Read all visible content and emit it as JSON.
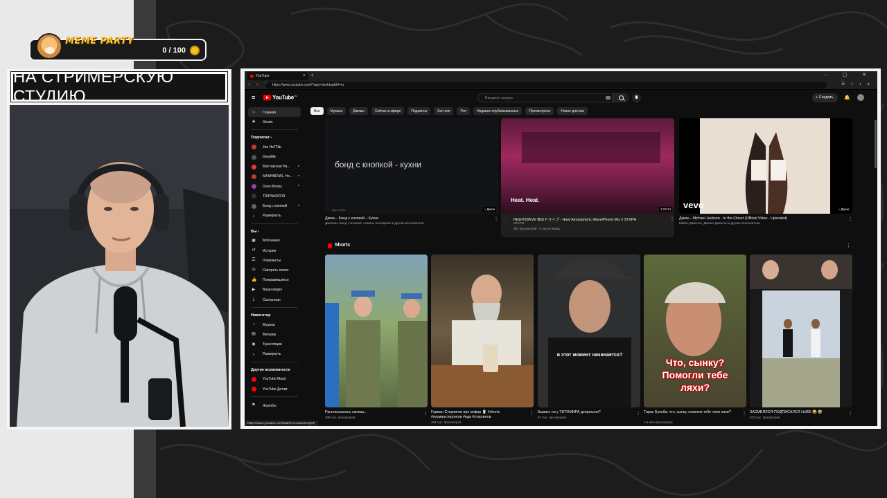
{
  "overlay": {
    "meme_party": {
      "title": "MEME PARTY",
      "counter": "0 / 100"
    },
    "cam_title": "НА СТРИМЕРСКУЮ СТУДИЮ"
  },
  "browser": {
    "tab_title": "YouTube",
    "url": "https://www.youtube.com/?app=desktop&hl=ru",
    "status_url": "https://www.youtube.com/watch?v=uzakUvuQOF"
  },
  "youtube": {
    "logo_text": "YouTube",
    "logo_region": "RU",
    "search_placeholder": "Введите запрос",
    "create_label": "Создать",
    "sidebar": {
      "main": [
        {
          "label": "Главная",
          "icon": "home-icon",
          "active": true
        },
        {
          "label": "Shorts",
          "icon": "shorts-icon",
          "active": false
        }
      ],
      "subs_title": "Подписки",
      "subscriptions": [
        {
          "label": "Joe HaTTab",
          "color": "#c0392b",
          "dot": false
        },
        {
          "label": "DeepMe",
          "color": "#555555",
          "dot": false
        },
        {
          "label": "Мастерская На...",
          "color": "#e23b3b",
          "dot": true
        },
        {
          "label": "MASHNEWS. Но...",
          "color": "#c0392b",
          "dot": true
        },
        {
          "label": "Drow Binsky",
          "color": "#8e44ad",
          "dot": true
        },
        {
          "label": "TRIPNADZOR",
          "color": "#333333",
          "dot": false
        },
        {
          "label": "Бонд с кнопкой",
          "color": "#666666",
          "dot": true
        }
      ],
      "expand_label": "Развернуть",
      "you_title": "Вы",
      "you_items": [
        {
          "label": "Мой канал",
          "icon": "channel-icon"
        },
        {
          "label": "История",
          "icon": "history-icon"
        },
        {
          "label": "Плейлисты",
          "icon": "playlists-icon"
        },
        {
          "label": "Смотреть позже",
          "icon": "watch-later-icon"
        },
        {
          "label": "Понравившиеся",
          "icon": "like-icon"
        },
        {
          "label": "Ваши видео",
          "icon": "your-videos-icon"
        },
        {
          "label": "Скачанные",
          "icon": "download-icon"
        }
      ],
      "nav_title": "Навигатор",
      "nav_items": [
        {
          "label": "Музыка",
          "icon": "music-icon"
        },
        {
          "label": "Фильмы",
          "icon": "film-icon"
        },
        {
          "label": "Трансляции",
          "icon": "live-icon"
        }
      ],
      "nav_expand": "Развернуть",
      "more_title": "Другие возможности",
      "more_items": [
        {
          "label": "YouTube Music",
          "icon": "yt-music-icon"
        },
        {
          "label": "YouTube Детям",
          "icon": "yt-kids-icon"
        }
      ],
      "complaints": "Жалобы"
    },
    "chips": [
      "Все",
      "Музыка",
      "Джемы",
      "Сейчас в эфире",
      "Подкасты",
      "Хип-хоп",
      "Рэп",
      "Недавно опубликованные",
      "Просмотрено",
      "Новое для вас"
    ],
    "videos": [
      {
        "title": "Джем – Бонд с кнопкой – Кухни",
        "sub": "Джиганы, Бонд с кнопкой, Анмаль Холодилин и другие исполнители",
        "overlay": "бонд с кнопкой - кухни",
        "badge": "Джем",
        "small": "июнь 2024"
      },
      {
        "title": "NIGHTDRIVE 夜のドライブ - Hard Atmospheric Wave/Phonk Mix // STXPH",
        "sub": "STXPH",
        "sub2": "367 просмотров · 9 часов назад",
        "overlay": "Heat. Heat.",
        "badge": "1:23:14"
      },
      {
        "title": "Джем – Michael Jackson - In the Closet (Official Video - Upscaled)",
        "sub": "Майкл Джексон, Джанет Джексон и другие исполнители",
        "overlay": "vevo",
        "badge": "Джем"
      }
    ],
    "shorts_title": "Shorts",
    "shorts": [
      {
        "title": "Расплескалась синева...",
        "views": "308 тыс. просмотров"
      },
      {
        "title": "Герман Стерлигов про кефир 🥛 #shorts #германстерлигов #еда #стерлигов",
        "views": "494 тыс. просмотров"
      },
      {
        "title": "Бывает ли у ТИТОМИРА депрессия?",
        "views": "97 тыс. просмотров",
        "caption": "в этот момент начинается?"
      },
      {
        "title": "Тарас Бульба: что, сынку, помогли тебе твои ляхи?",
        "views": "2,6 млн просмотров",
        "caption": "Что, сынку? Помогли тебе ляхи?"
      },
      {
        "title": "ЗАСМЕЯЛСЯ-ПОДПИСАЛСЯ №365 😂 🤣",
        "views": "833 тыс. просмотров"
      }
    ]
  }
}
